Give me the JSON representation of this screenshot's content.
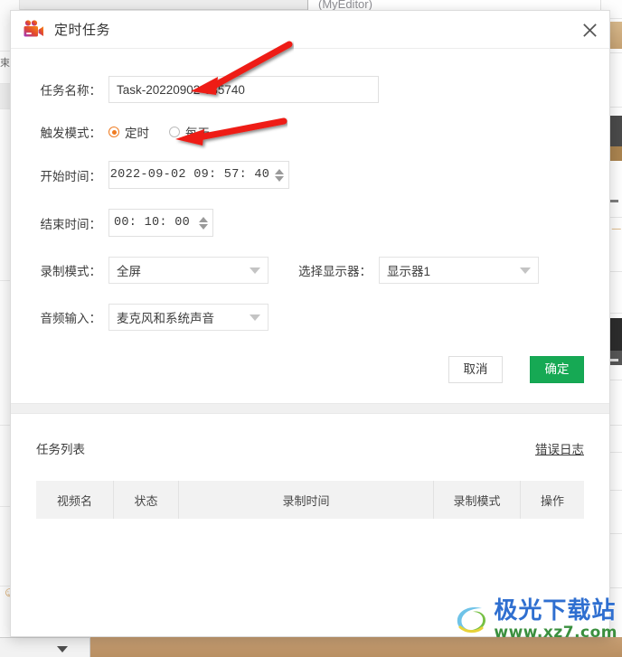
{
  "dialog": {
    "title": "定时任务",
    "icon": "video-camera-icon",
    "close_label": "×",
    "accent_green": "#16a954",
    "accent_orange": "#ef7b21"
  },
  "form": {
    "task_name": {
      "label": "任务名称：",
      "value": "Task-20220902-085740",
      "placeholder": ""
    },
    "trigger_mode": {
      "label": "触发模式：",
      "options": [
        {
          "label": "定时",
          "selected": true
        },
        {
          "label": "每天",
          "selected": false
        }
      ]
    },
    "start_time": {
      "label": "开始时间：",
      "value": "2022-09-02 09: 57: 40"
    },
    "end_time": {
      "label": "结束时间：",
      "value": "00: 10: 00"
    },
    "record_mode": {
      "label": "录制模式：",
      "value": "全屏"
    },
    "monitor": {
      "label": "选择显示器：",
      "value": "显示器1"
    },
    "audio_input": {
      "label": "音频输入：",
      "value": "麦克风和系统声音"
    }
  },
  "buttons": {
    "cancel": "取消",
    "confirm": "确定"
  },
  "task_list": {
    "title": "任务列表",
    "error_log": "错误日志",
    "columns": [
      "视频名",
      "状态",
      "录制时间",
      "录制模式",
      "操作"
    ],
    "rows": []
  },
  "background": {
    "top_window_title": "(MyEditor)"
  },
  "watermark": {
    "site_name": "极光下载站",
    "url": "www.xz7.com"
  }
}
